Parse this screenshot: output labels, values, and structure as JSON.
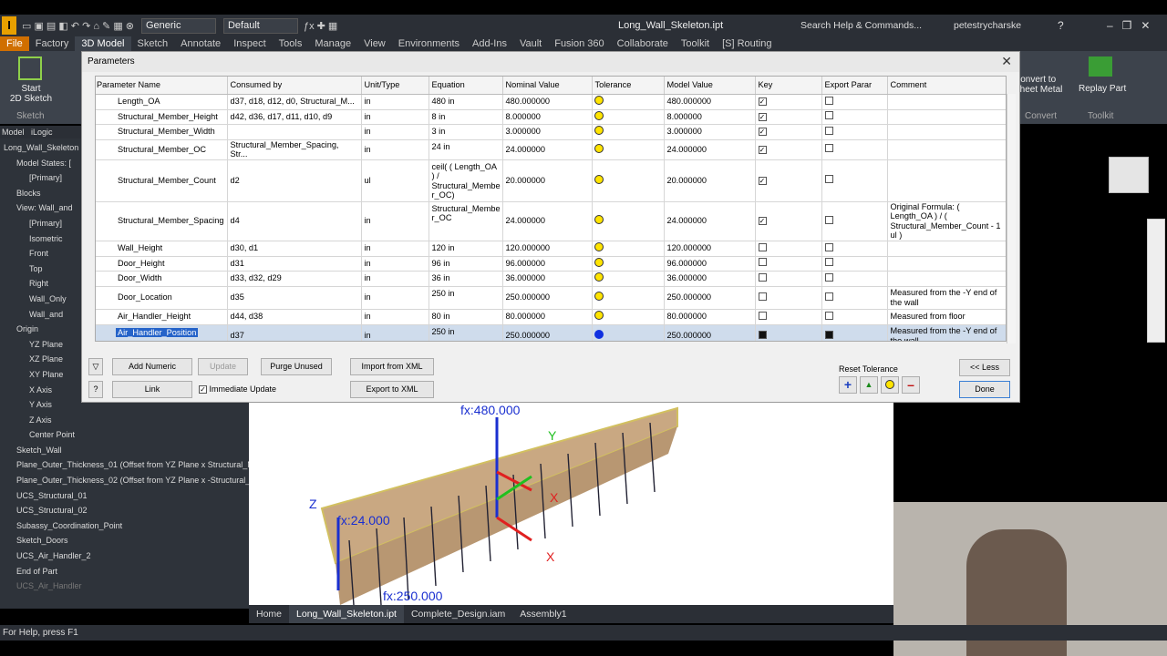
{
  "app": {
    "logo": "I",
    "file_title": "Long_Wall_Skeleton.ipt",
    "search_placeholder": "Search Help & Commands...",
    "user": "petestrycharske",
    "material": "Generic",
    "appearance": "Default"
  },
  "ribbon_tabs": [
    "File",
    "Factory",
    "3D Model",
    "Sketch",
    "Annotate",
    "Inspect",
    "Tools",
    "Manage",
    "View",
    "Environments",
    "Add-Ins",
    "Vault",
    "Fusion 360",
    "Collaborate",
    "Toolkit",
    "[S] Routing"
  ],
  "ribbon": {
    "start_sketch": "Start\n2D Sketch",
    "sketch_group": "Sketch",
    "convert": "Convert to\nSheet Metal",
    "convert_group": "Convert",
    "replay": "Replay Part",
    "toolkit_group": "Toolkit"
  },
  "browser": {
    "tabs": [
      "Model",
      "iLogic"
    ],
    "items": [
      "Long_Wall_Skeleton",
      "Model States: [",
      "[Primary]",
      "Blocks",
      "View: Wall_and",
      "[Primary]",
      "Isometric",
      "Front",
      "Top",
      "Right",
      "Wall_Only",
      "Wall_and",
      "Origin",
      "YZ Plane",
      "XZ Plane",
      "XY Plane",
      "X Axis",
      "Y Axis",
      "Z Axis",
      "Center Point",
      "Sketch_Wall",
      "Plane_Outer_Thickness_01 (Offset from YZ Plane x Structural_M",
      "Plane_Outer_Thickness_02 (Offset from YZ Plane x -Structural_",
      "UCS_Structural_01",
      "UCS_Structural_02",
      "Subassy_Coordination_Point",
      "Sketch_Doors",
      "UCS_Air_Handler_2",
      "End of Part",
      "UCS_Air_Handler"
    ]
  },
  "dialog": {
    "title": "Parameters",
    "columns": [
      "Parameter Name",
      "Consumed by",
      "Unit/Type",
      "Equation",
      "Nominal Value",
      "Tolerance",
      "Model Value",
      "Key",
      "Export Parar",
      "Comment"
    ],
    "rows": [
      {
        "name": "Length_OA",
        "consumed": "d37, d18, d12, d0, Structural_M...",
        "unit": "in",
        "eq": "480 in",
        "nominal": "480.000000",
        "model": "480.000000",
        "key": true,
        "export": false,
        "comment": ""
      },
      {
        "name": "Structural_Member_Height",
        "consumed": "d42, d36, d17, d11, d10, d9",
        "unit": "in",
        "eq": "8 in",
        "nominal": "8.000000",
        "model": "8.000000",
        "key": true,
        "export": false,
        "comment": ""
      },
      {
        "name": "Structural_Member_Width",
        "consumed": "",
        "unit": "in",
        "eq": "3 in",
        "nominal": "3.000000",
        "model": "3.000000",
        "key": true,
        "export": false,
        "comment": ""
      },
      {
        "name": "Structural_Member_OC",
        "consumed": "Structural_Member_Spacing, Str...",
        "unit": "in",
        "eq": "24 in",
        "nominal": "24.000000",
        "model": "24.000000",
        "key": true,
        "export": false,
        "comment": ""
      },
      {
        "name": "Structural_Member_Count",
        "consumed": "d2",
        "unit": "ul",
        "eq": "ceil( ( Length_OA ) / Structural_Membe r_OC)",
        "nominal": "20.000000",
        "model": "20.000000",
        "key": true,
        "export": false,
        "comment": ""
      },
      {
        "name": "Structural_Member_Spacing",
        "consumed": "d4",
        "unit": "in",
        "eq": "Structural_Membe r_OC",
        "nominal": "24.000000",
        "model": "24.000000",
        "key": true,
        "export": false,
        "comment": "Original Formula: ( Length_OA ) / ( Structural_Member_Count - 1 ul )"
      },
      {
        "name": "Wall_Height",
        "consumed": "d30, d1",
        "unit": "in",
        "eq": "120 in",
        "nominal": "120.000000",
        "model": "120.000000",
        "key": false,
        "export": false,
        "comment": ""
      },
      {
        "name": "Door_Height",
        "consumed": "d31",
        "unit": "in",
        "eq": "96 in",
        "nominal": "96.000000",
        "model": "96.000000",
        "key": false,
        "export": false,
        "comment": ""
      },
      {
        "name": "Door_Width",
        "consumed": "d33, d32, d29",
        "unit": "in",
        "eq": "36 in",
        "nominal": "36.000000",
        "model": "36.000000",
        "key": false,
        "export": false,
        "comment": ""
      },
      {
        "name": "Door_Location",
        "consumed": "d35",
        "unit": "in",
        "eq": "250 in",
        "nominal": "250.000000",
        "model": "250.000000",
        "key": false,
        "export": false,
        "comment": "Measured from the -Y end of the wall"
      },
      {
        "name": "Air_Handler_Height",
        "consumed": "d44, d38",
        "unit": "in",
        "eq": "80 in",
        "nominal": "80.000000",
        "model": "80.000000",
        "key": false,
        "export": false,
        "comment": "Measured from floor"
      },
      {
        "name": "Air_Handler_Position",
        "consumed": "d37",
        "unit": "in",
        "eq": "250 in",
        "nominal": "250.000000",
        "model": "250.000000",
        "key": true,
        "export": true,
        "comment": "Measured from the -Y end of the wall"
      }
    ],
    "buttons": {
      "add_numeric": "Add Numeric",
      "update": "Update",
      "purge": "Purge Unused",
      "import": "Import from XML",
      "link": "Link",
      "immediate": "Immediate Update",
      "export": "Export to XML",
      "less": "<< Less",
      "done": "Done",
      "reset_tol": "Reset Tolerance"
    }
  },
  "viewport": {
    "labels": [
      "fx:480.000",
      "fx:24.000",
      "fx:250.000",
      "Y",
      "X",
      "X",
      "Z"
    ]
  },
  "doc_tabs": [
    "Home",
    "Long_Wall_Skeleton.ipt",
    "Complete_Design.iam",
    "Assembly1"
  ],
  "status": "For Help, press F1"
}
